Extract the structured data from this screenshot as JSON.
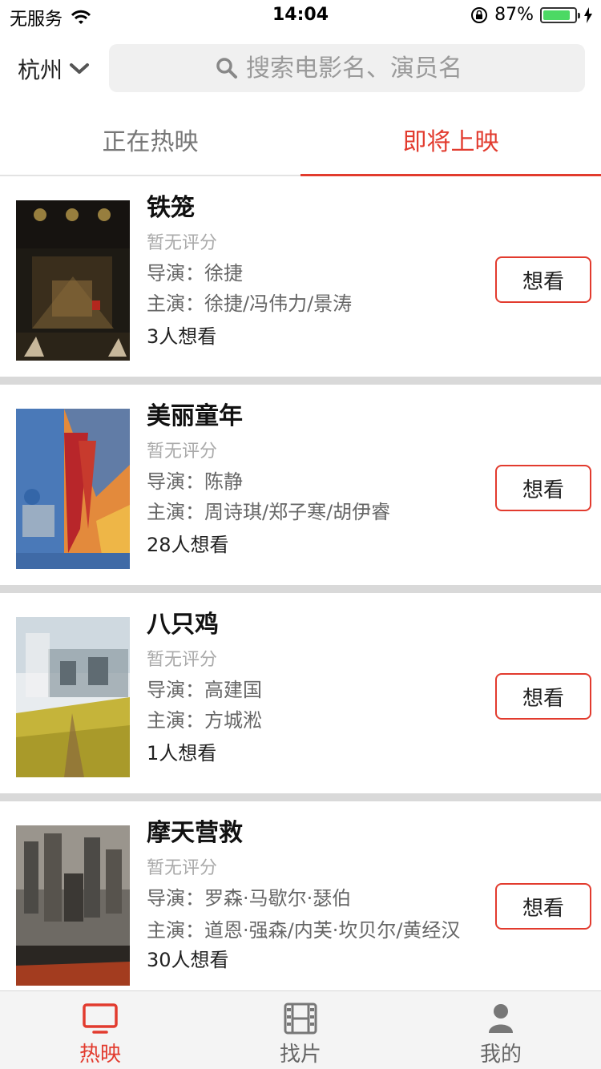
{
  "status_bar": {
    "carrier": "无服务",
    "time": "14:04",
    "battery": "87%",
    "battery_level": 0.87
  },
  "header": {
    "city": "杭州",
    "search_placeholder": "搜索电影名、演员名"
  },
  "tabs": [
    {
      "label": "正在热映",
      "active": false
    },
    {
      "label": "即将上映",
      "active": true
    }
  ],
  "movies": [
    {
      "title": "铁笼",
      "rating": "暂无评分",
      "director_label": "导演：",
      "director": "徐捷",
      "cast_label": "主演：",
      "cast": "徐捷/冯伟力/景涛",
      "want_count": "3人想看",
      "button": "想看"
    },
    {
      "title": "美丽童年",
      "rating": "暂无评分",
      "director_label": "导演：",
      "director": "陈静",
      "cast_label": "主演：",
      "cast": "周诗琪/郑子寒/胡伊睿",
      "want_count": "28人想看",
      "button": "想看"
    },
    {
      "title": "八只鸡",
      "rating": "暂无评分",
      "director_label": "导演：",
      "director": "高建国",
      "cast_label": "主演：",
      "cast": "方城淞",
      "want_count": "1人想看",
      "button": "想看"
    },
    {
      "title": "摩天营救",
      "rating": "暂无评分",
      "director_label": "导演：",
      "director": "罗森·马歇尔·瑟伯",
      "cast_label": "主演：",
      "cast": "道恩·强森/内芙·坎贝尔/黄经汉",
      "want_count": "30人想看",
      "button": "想看"
    }
  ],
  "tabbar": [
    {
      "label": "热映",
      "icon": "tv-icon",
      "active": true
    },
    {
      "label": "找片",
      "icon": "film-icon",
      "active": false
    },
    {
      "label": "我的",
      "icon": "user-icon",
      "active": false
    }
  ],
  "colors": {
    "accent": "#e23b2e",
    "separator": "#d9d9d9",
    "tabbar_bg": "#f4f4f4"
  }
}
